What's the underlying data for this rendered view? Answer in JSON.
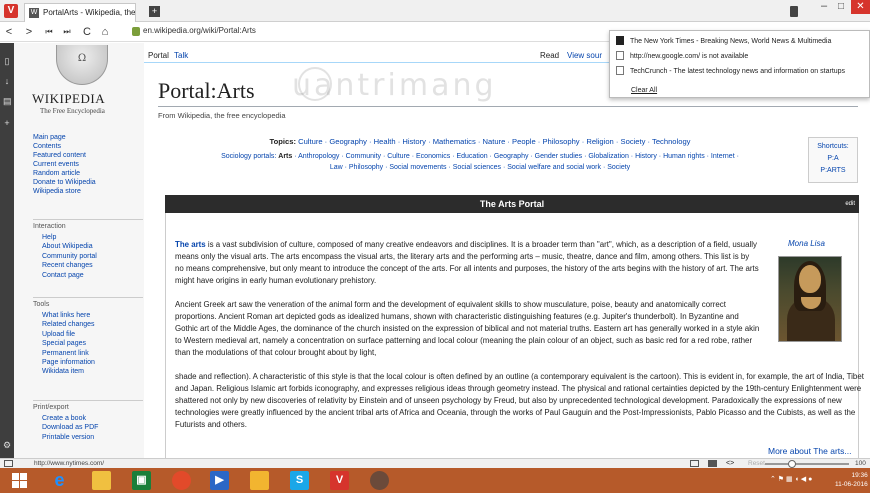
{
  "browser": {
    "tab_title": "PortalArts - Wikipedia, the",
    "url": "en.wikipedia.org/wiki/Portal:Arts",
    "window_controls": {
      "minimize": "–",
      "maximize": "□",
      "close": "✕"
    },
    "accent_color": "#d6342c"
  },
  "nav": {
    "back": "<",
    "forward": ">",
    "rewind": "⏮",
    "fastforward": "⏭",
    "reload": "C",
    "home": "⌂"
  },
  "history_dropdown": {
    "items": [
      "The New York Times - Breaking News, World News & Multimedia",
      "http://new.google.com/ is not available",
      "TechCrunch - The latest technology news and information on startups"
    ],
    "clear": "Clear All"
  },
  "wiki": {
    "wordmark": "WIKIPEDIA",
    "tagline": "The Free Encyclopedia",
    "nav": [
      "Main page",
      "Contents",
      "Featured content",
      "Current events",
      "Random article",
      "Donate to Wikipedia",
      "Wikipedia store"
    ],
    "interaction_head": "Interaction",
    "interaction": [
      "Help",
      "About Wikipedia",
      "Community portal",
      "Recent changes",
      "Contact page"
    ],
    "tools_head": "Tools",
    "tools": [
      "What links here",
      "Related changes",
      "Upload file",
      "Special pages",
      "Permanent link",
      "Page information",
      "Wikidata item"
    ],
    "print_head": "Print/export",
    "print": [
      "Create a book",
      "Download as PDF",
      "Printable version"
    ]
  },
  "page": {
    "tab_portal": "Portal",
    "tab_talk": "Talk",
    "tab_read": "Read",
    "tab_view_source": "View sour",
    "title": "Portal:Arts",
    "from": "From Wikipedia, the free encyclopedia",
    "watermark": "uantrimang",
    "topics_label": "Topics:",
    "topics": "Culture · Geography · Health · History · Mathematics · Nature · People · Philosophy · Religion · Society · Technology",
    "sociology_label": "Sociology portals:",
    "sociology_arts": "Arts",
    "portals_line1": "· Anthropology · Community · Culture · Economics · Education · Geography · Gender studies · Globalization · History · Human rights · Internet ·",
    "portals_line2": "Law · Philosophy · Social movements · Social sciences · Social welfare and social work · Society",
    "shortcuts_label": "Shortcuts:",
    "shortcut1": "P:A",
    "shortcut2": "P:ARTS",
    "portal_header": "The Arts Portal",
    "edit": "edit",
    "image_caption": "Mona Lisa",
    "more_about": "More about The arts...",
    "para1_bold": "The arts",
    "para1": " is a vast subdivision of culture, composed of many creative endeavors and disciplines. It is a broader term than \"art\", which, as a description of a field, usually means only the visual arts. The arts encompass the visual arts, the literary arts and the performing arts – music, theatre, dance and film, among others. This list is by no means comprehensive, but only meant to introduce the concept of the arts. For all intents and purposes, the history of the arts begins with the history of art. The arts might have origins in early human evolutionary prehistory.",
    "para2a": "Ancient Greek art saw the veneration of the animal form and the development of equivalent skills to show musculature, poise, beauty and anatomically correct proportions. Ancient Roman art depicted gods as idealized humans, shown with characteristic distinguishing features (e.g. Jupiter's thunderbolt). In Byzantine and Gothic art of the Middle Ages, the dominance of the church insisted on the expression of biblical and not material truths. Eastern art has generally worked in a style akin to Western medieval art, namely a concentration on surface patterning and local colour (meaning the plain colour of an object, such as basic red for a red robe, rather than the modulations of that colour brought about by light,",
    "para2b": "shade and reflection). A characteristic of this style is that the local colour is often defined by an outline (a contemporary equivalent is the cartoon). This is evident in, for example, the art of India, Tibet and Japan. Religious Islamic art forbids iconography, and expresses religious ideas through geometry instead. The physical and rational certainties depicted by the 19th-century Enlightenment were shattered not only by new discoveries of relativity by Einstein and of unseen psychology by Freud, but also by unprecedented technological development. Paradoxically the expressions of new technologies were greatly influenced by the ancient tribal arts of Africa and Oceania, through the works of Paul Gauguin and the Post-Impressionists, Pablo Picasso and the Cubists, as well as the Futurists and others."
  },
  "status": {
    "hover_url": "http://www.nytimes.com/",
    "reset": "Reset",
    "zoom": "100"
  },
  "taskbar": {
    "clock_time": "19:36",
    "clock_date": "11-06-2016",
    "color": "#b65a2a"
  }
}
